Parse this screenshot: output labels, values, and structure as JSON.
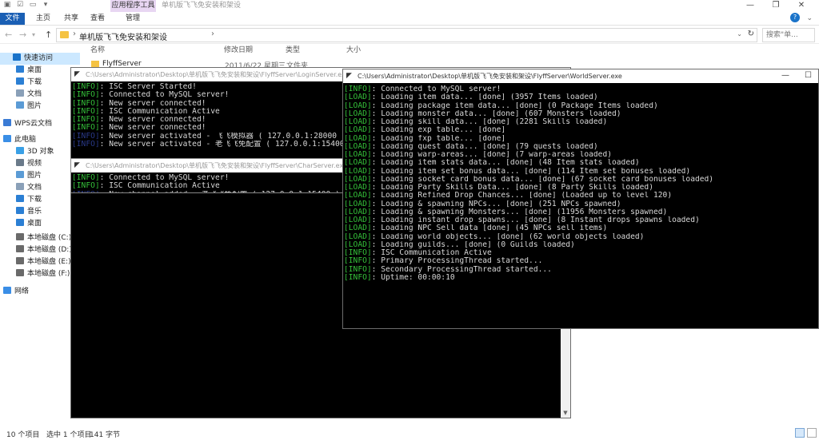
{
  "explorer": {
    "title": "单机版飞飞免安装和架设",
    "contextual_tab": "应用程序工具",
    "ribbon_tabs": [
      "文件",
      "主页",
      "共享",
      "查看",
      "管理"
    ],
    "address": "单机版飞飞免安装和架设",
    "search_placeholder": "搜索\"单...",
    "columns": [
      "名称",
      "修改日期",
      "类型",
      "大小"
    ],
    "files": [
      {
        "name": "FlyffServer",
        "date": "2011/6/22 星期三 ...",
        "type": "文件夹"
      }
    ],
    "nav_items": [
      {
        "label": "快速访问",
        "icon": "star-icon",
        "color": "#1a73c9"
      },
      {
        "label": "桌面",
        "icon": "desktop-icon",
        "color": "#2b7fd4"
      },
      {
        "label": "下载",
        "icon": "download-icon",
        "color": "#2b7fd4"
      },
      {
        "label": "文档",
        "icon": "document-icon",
        "color": "#8aa0b8"
      },
      {
        "label": "图片",
        "icon": "picture-icon",
        "color": "#5b9bd5"
      },
      {
        "label": "WPS云文档",
        "icon": "cloud-icon",
        "color": "#3a7bd5"
      },
      {
        "label": "此电脑",
        "icon": "computer-icon",
        "color": "#3a8ee6"
      },
      {
        "label": "3D 对象",
        "icon": "cube-icon",
        "color": "#3aa0e6"
      },
      {
        "label": "视频",
        "icon": "video-icon",
        "color": "#6a7a8a"
      },
      {
        "label": "图片",
        "icon": "picture-icon",
        "color": "#5b9bd5"
      },
      {
        "label": "文档",
        "icon": "document-icon",
        "color": "#8aa0b8"
      },
      {
        "label": "下载",
        "icon": "download-icon",
        "color": "#2b7fd4"
      },
      {
        "label": "音乐",
        "icon": "music-icon",
        "color": "#2b7fd4"
      },
      {
        "label": "桌面",
        "icon": "desktop-icon",
        "color": "#2b7fd4"
      },
      {
        "label": "本地磁盘 (C:)",
        "icon": "drive-icon",
        "color": "#6a6a6a"
      },
      {
        "label": "本地磁盘 (D:)",
        "icon": "drive-icon",
        "color": "#6a6a6a"
      },
      {
        "label": "本地磁盘 (E:)",
        "icon": "drive-icon",
        "color": "#6a6a6a"
      },
      {
        "label": "本地磁盘 (F:)",
        "icon": "drive-icon",
        "color": "#6a6a6a"
      },
      {
        "label": "网络",
        "icon": "network-icon",
        "color": "#3a8ee6"
      }
    ],
    "status": {
      "count": "10 个项目",
      "selected": "选中 1 个项目",
      "size": "141 字节"
    }
  },
  "consoles": {
    "login": {
      "title": "C:\\Users\\Administrator\\Desktop\\单机版飞飞免安装和架设\\FlyffServer\\LoginServer.exe",
      "lines": [
        {
          "tag": "[INFO]",
          "text": ": ISC Server Started!"
        },
        {
          "tag": "[INFO]",
          "text": ": Connected to MySQL server!"
        },
        {
          "tag": "[INFO]",
          "text": ": New server connected!"
        },
        {
          "tag": "[INFO]",
          "text": ": ISC Communication Active"
        },
        {
          "tag": "[INFO]",
          "text": ": New server connected!"
        },
        {
          "tag": "[INFO]",
          "text": ": New server connected!"
        },
        {
          "tag": "[INFO]",
          "text": ": New server activated - 飞飞模拟器 ( 127.0.0.1:28000 )",
          "dim": true
        },
        {
          "tag": "[INFO]",
          "text": ": New server activated - 老飞飞免配置 ( 127.0.0.1:15400 )",
          "dim": true
        }
      ]
    },
    "char": {
      "title": "C:\\Users\\Administrator\\Desktop\\单机版飞飞免安装和架设\\FlyffServer\\CharServer.exe",
      "lines": [
        {
          "tag": "[INFO]",
          "text": ": Connected to MySQL server!"
        },
        {
          "tag": "[INFO]",
          "text": ": ISC Communication Active"
        },
        {
          "tag": "[INFO]",
          "text": ": New channel added - 老飞飞免配置 ( 127.0.0.1:15400 )",
          "dim": true
        }
      ]
    },
    "world": {
      "title": "C:\\Users\\Administrator\\Desktop\\单机版飞飞免安装和架设\\FlyffServer\\WorldServer.exe",
      "lines": [
        {
          "tag": "[INFO]",
          "text": ": Connected to MySQL server!"
        },
        {
          "tag": "[LOAD]",
          "text": ": Loading item data... [done] (3957 Items loaded)"
        },
        {
          "tag": "[LOAD]",
          "text": ": Loading package item data... [done] (0 Package Items loaded)"
        },
        {
          "tag": "[LOAD]",
          "text": ": Loading monster data... [done] (607 Monsters loaded)"
        },
        {
          "tag": "[LOAD]",
          "text": ": Loading skill data... [done] (2281 Skills loaded)"
        },
        {
          "tag": "[LOAD]",
          "text": ": Loading exp table... [done]"
        },
        {
          "tag": "[LOAD]",
          "text": ": Loading fxp table... [done]"
        },
        {
          "tag": "[LOAD]",
          "text": ": Loading quest data... [done] (79 quests loaded)"
        },
        {
          "tag": "[LOAD]",
          "text": ": Loading warp-areas... [done] (7 warp-areas loaded)"
        },
        {
          "tag": "[LOAD]",
          "text": ": Loading item stats data... [done] (48 Item stats loaded)"
        },
        {
          "tag": "[LOAD]",
          "text": ": Loading item set bonus data... [done] (114 Item set bonuses loaded)"
        },
        {
          "tag": "[LOAD]",
          "text": ": Loading socket card bonus data... [done] (67 socket card bonuses loaded)"
        },
        {
          "tag": "[LOAD]",
          "text": ": Loading Party Skills Data... [done] (8 Party Skills loaded)"
        },
        {
          "tag": "[LOAD]",
          "text": ": Loading Refined Drop Chances... [done] (Loaded up to level 120)"
        },
        {
          "tag": "[LOAD]",
          "text": ": Loading & spawning NPCs... [done] (251 NPCs spawned)"
        },
        {
          "tag": "[LOAD]",
          "text": ": Loading & spawning Monsters... [done] (11956 Monsters spawned)"
        },
        {
          "tag": "[LOAD]",
          "text": ": Loading instant drop spawns... [done] (8 Instant drops spawns loaded)"
        },
        {
          "tag": "[LOAD]",
          "text": ": Loading NPC Sell data [done] (45 NPCs sell items)"
        },
        {
          "tag": "[LOAD]",
          "text": ": Loading world objects... [done] (62 world objects loaded)"
        },
        {
          "tag": "[LOAD]",
          "text": ": Loading guilds... [done] (0 Guilds loaded)"
        },
        {
          "tag": "[INFO]",
          "text": ": ISC Communication Active"
        },
        {
          "tag": "[INFO]",
          "text": ": Primary ProcessingThread started..."
        },
        {
          "tag": "[INFO]",
          "text": ": Secondary ProcessingThread started..."
        },
        {
          "tag": "[INFO]",
          "text": ": Uptime: 00:00:10"
        }
      ]
    }
  }
}
